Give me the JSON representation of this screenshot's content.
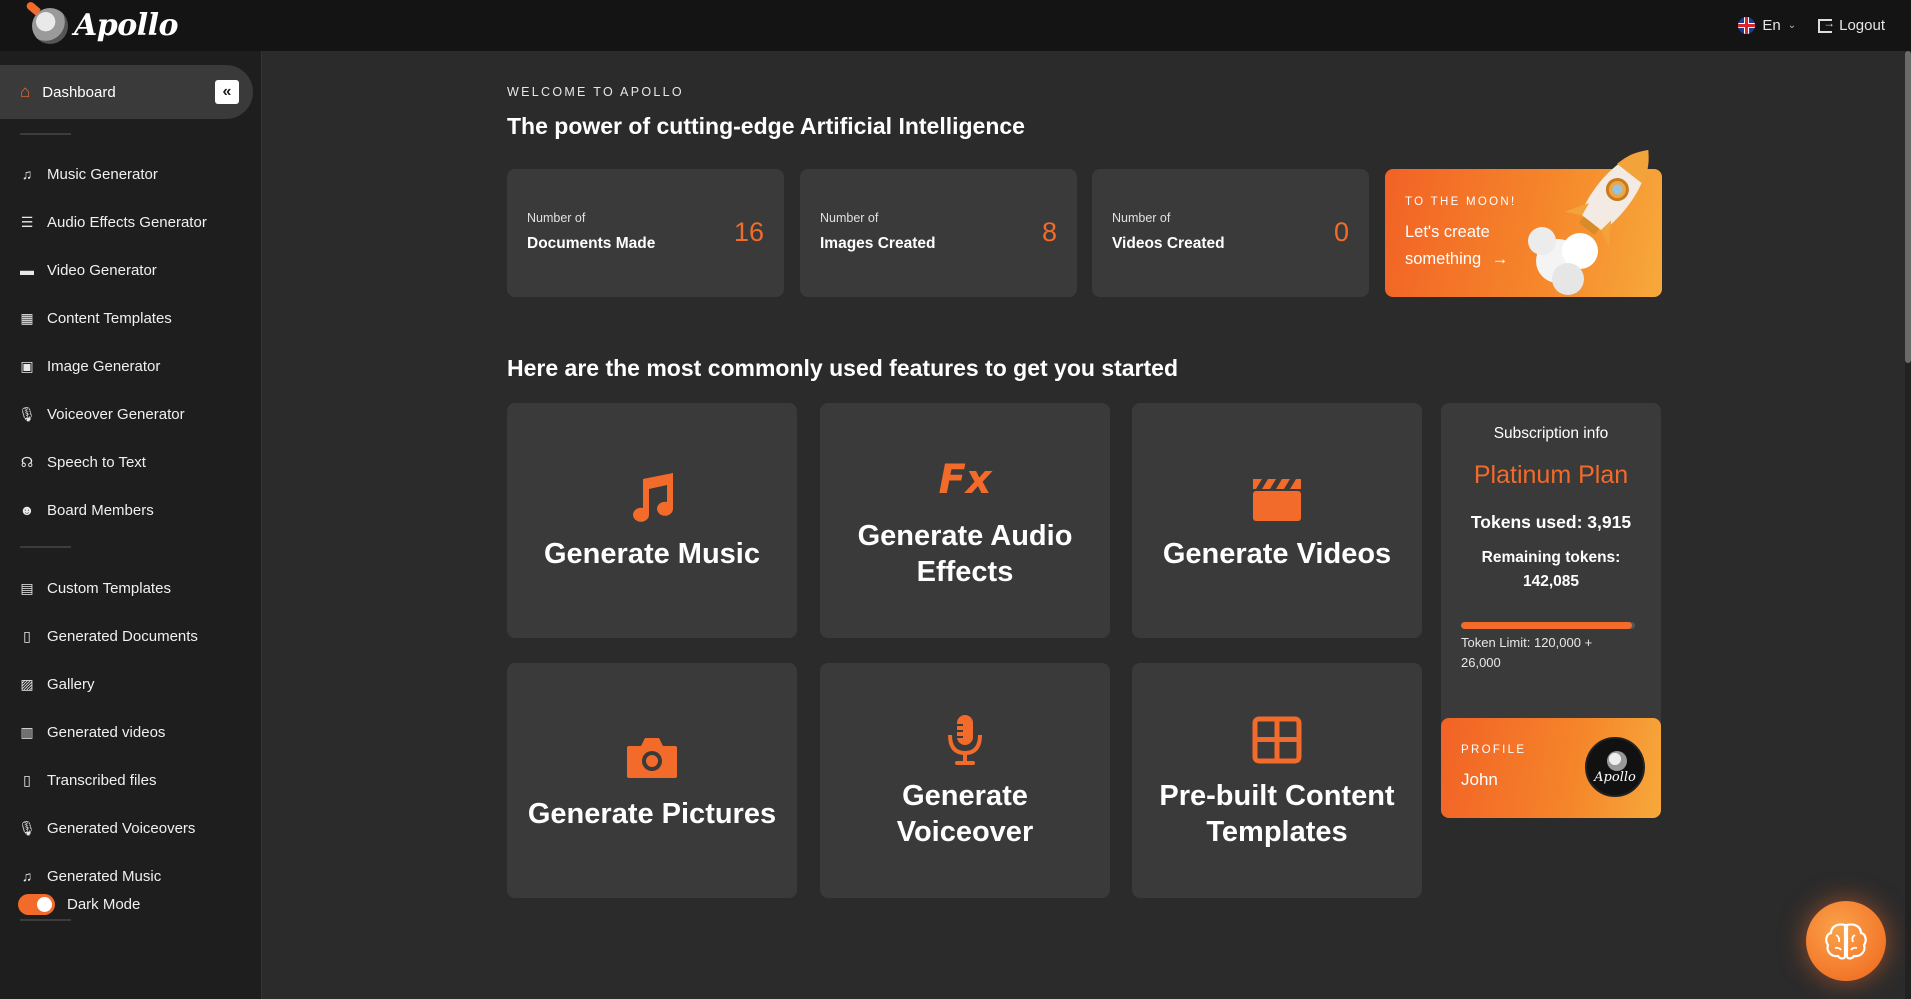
{
  "app": {
    "brand_name": "Apollo",
    "accent_color": "#f26b2a"
  },
  "topbar": {
    "language": "En",
    "logout_label": "Logout"
  },
  "sidebar": {
    "active_item": {
      "label": "Dashboard",
      "icon": "home-icon"
    },
    "collapse_icon": "double-chevron-left-icon",
    "group1": [
      {
        "label": "Music Generator",
        "icon": "music-note-icon"
      },
      {
        "label": "Audio Effects Generator",
        "icon": "sliders-icon"
      },
      {
        "label": "Video Generator",
        "icon": "clapperboard-icon"
      },
      {
        "label": "Content Templates",
        "icon": "templates-icon"
      },
      {
        "label": "Image Generator",
        "icon": "image-icon"
      },
      {
        "label": "Voiceover Generator",
        "icon": "microphone-icon"
      },
      {
        "label": "Speech to Text",
        "icon": "headset-icon"
      },
      {
        "label": "Board Members",
        "icon": "users-icon"
      }
    ],
    "group2": [
      {
        "label": "Custom Templates",
        "icon": "briefcase-icon"
      },
      {
        "label": "Generated Documents",
        "icon": "document-icon"
      },
      {
        "label": "Gallery",
        "icon": "gallery-icon"
      },
      {
        "label": "Generated videos",
        "icon": "film-icon"
      },
      {
        "label": "Transcribed files",
        "icon": "file-icon"
      },
      {
        "label": "Generated Voiceovers",
        "icon": "microphone-icon"
      },
      {
        "label": "Generated Music",
        "icon": "music-note-icon"
      }
    ],
    "dark_mode_label": "Dark Mode",
    "dark_mode_on": true
  },
  "main": {
    "eyebrow": "WELCOME TO APOLLO",
    "headline": "The power of cutting-edge Artificial Intelligence",
    "stats": [
      {
        "small": "Number of",
        "big": "Documents Made",
        "value": "16"
      },
      {
        "small": "Number of",
        "big": "Images Created",
        "value": "8"
      },
      {
        "small": "Number of",
        "big": "Videos Created",
        "value": "0"
      }
    ],
    "moon_card": {
      "tag": "TO THE MOON!",
      "cta": "Let's create something",
      "arrow": "→"
    },
    "section_title": "Here are the most commonly used features to get you started",
    "features": [
      {
        "title": "Generate Music",
        "icon": "music-note-icon"
      },
      {
        "title": "Generate Audio Effects",
        "icon": "fx-icon",
        "icon_text": "Fx"
      },
      {
        "title": "Generate Videos",
        "icon": "clapperboard-icon"
      },
      {
        "title": "Generate Pictures",
        "icon": "camera-icon"
      },
      {
        "title": "Generate Voiceover",
        "icon": "microphone-icon"
      },
      {
        "title": "Pre-built Content Templates",
        "icon": "grid-icon"
      }
    ]
  },
  "subscription": {
    "title": "Subscription info",
    "plan": "Platinum Plan",
    "tokens_used": "Tokens used: 3,915",
    "remaining_label": "Remaining tokens:",
    "remaining_value": "142,085",
    "usage_fraction": 0.98,
    "limit_text": "Token Limit: 120,000 + 26,000"
  },
  "profile": {
    "tag": "PROFILE",
    "name": "John",
    "avatar_text": "Apollo"
  },
  "fab": {
    "icon": "brain-icon"
  }
}
